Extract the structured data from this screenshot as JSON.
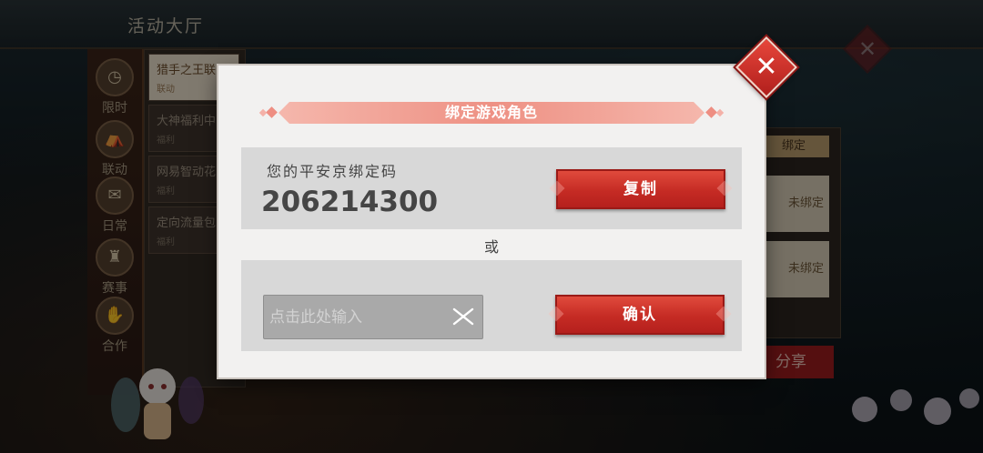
{
  "background": {
    "hall_title": "活动大厅",
    "headline": "联动",
    "sidebar": [
      {
        "label": "限时",
        "icon": "clock-icon",
        "glyph": "◷"
      },
      {
        "label": "联动",
        "icon": "tent-icon",
        "glyph": "⛺"
      },
      {
        "label": "日常",
        "icon": "gift-icon",
        "glyph": "✉"
      },
      {
        "label": "赛事",
        "icon": "trophy-icon",
        "glyph": "♜"
      },
      {
        "label": "合作",
        "icon": "handshake-icon",
        "glyph": "✋"
      }
    ],
    "list": [
      {
        "title": "猎手之王联",
        "sub": "联动"
      },
      {
        "title": "大神福利中",
        "sub": "福利"
      },
      {
        "title": "网易智动花",
        "sub": "福利"
      },
      {
        "title": "定向流量包",
        "sub": "福利"
      }
    ],
    "right_tag": "绑定",
    "right_cards": [
      "未绑定",
      "未绑定"
    ],
    "share_label": "分享"
  },
  "modal": {
    "title": "绑定游戏角色",
    "code_label": "您的平安京绑定码",
    "code_value": "206214300",
    "copy_label": "复制",
    "or_text": "或",
    "input_placeholder": "点击此处输入",
    "input_value": "",
    "confirm_label": "确认",
    "close_icon": "close-icon",
    "clear_icon": "clear-icon"
  },
  "colors": {
    "accent_red": "#c52b24",
    "ribbon_pink": "#ee9184",
    "modal_bg": "#f2f1f0",
    "panel_gray": "#d8d8d8"
  }
}
